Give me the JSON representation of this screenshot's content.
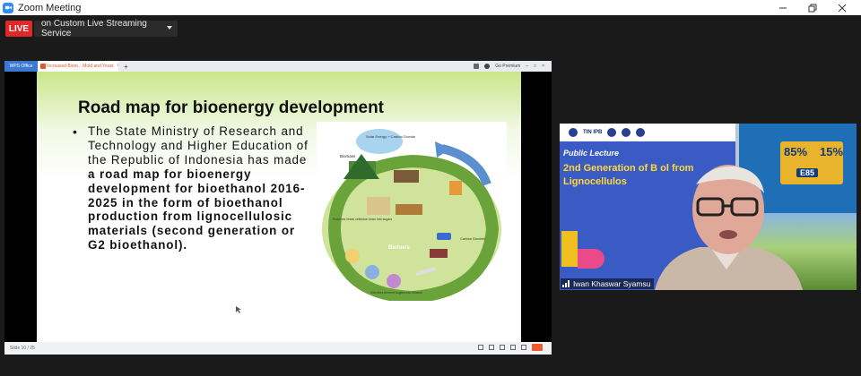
{
  "window": {
    "title": "Zoom Meeting"
  },
  "live": {
    "badge": "LIVE",
    "service": "on Custom Live Streaming Service"
  },
  "wps": {
    "home_tab": "WPS Office",
    "doc_tab": "Increased Bioet... Mold and Yeast",
    "slide_number": "Slide 10 / 25",
    "account": "Go Premium"
  },
  "slide": {
    "title": "Road map for bioenergy development",
    "bullet": "•",
    "body_plain": "The State Ministry of Research and Technology and Higher Education of the Republic of Indonesia has made ",
    "body_bold": "a road map for bioenergy development for bioethanol 2016-2025 in the form of bioethanol production from lignocellulosic materials (second generation or G2 bioethanol).",
    "diagram": {
      "sun_label": "Solar Energy + Carbon Dioxide",
      "biomass": "Biomass",
      "biofuels": "Biofuels",
      "carbon_dioxide": "Carbon Dioxide",
      "enzymes": "Enzymes break cellulose down into sugars",
      "microbes": "Microbes ferment sugars into ethanol"
    }
  },
  "video": {
    "bg_title": "Public Lecture",
    "bg_subtitle": "2nd Generation of B    ol from Lignocellulos",
    "logo_text": "TIN IPB",
    "pump_85": "85%",
    "pump_15": "15%",
    "pump_e85": "E85",
    "participant_name": "Iwan Khaswar Syamsu"
  },
  "colors": {
    "live_red": "#e02828",
    "zoom_blue": "#2d8cff",
    "slide_green": "#c9e68a"
  }
}
